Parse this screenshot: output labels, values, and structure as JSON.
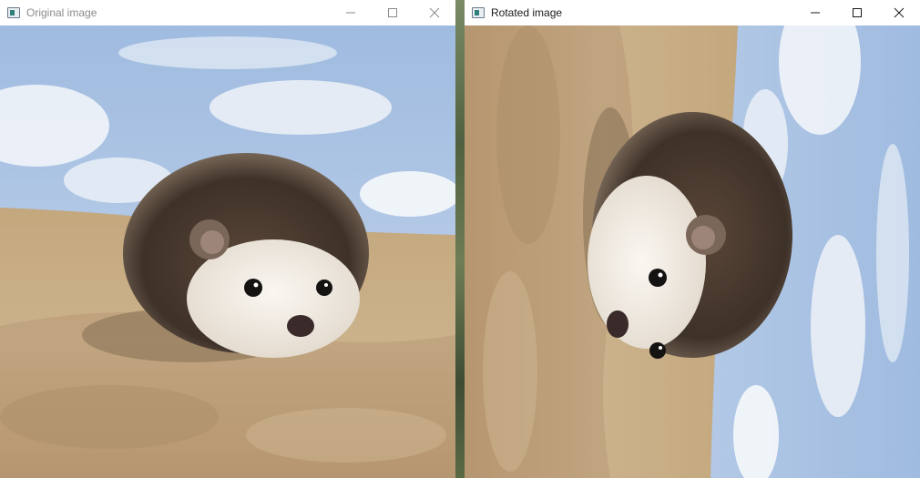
{
  "windows": [
    {
      "title": "Original image",
      "image_alt": "hedgehog-photo"
    },
    {
      "title": "Rotated image",
      "image_alt": "hedgehog-photo-rotated-90"
    }
  ],
  "caption_icons": [
    "minimize-icon",
    "maximize-icon",
    "close-icon"
  ],
  "colors": {
    "sky": "#aac3e6",
    "cloud": "#f3f6fb",
    "rock": "#c9ad84",
    "spines": "#4a3b30",
    "fur": "#f1ede7"
  }
}
